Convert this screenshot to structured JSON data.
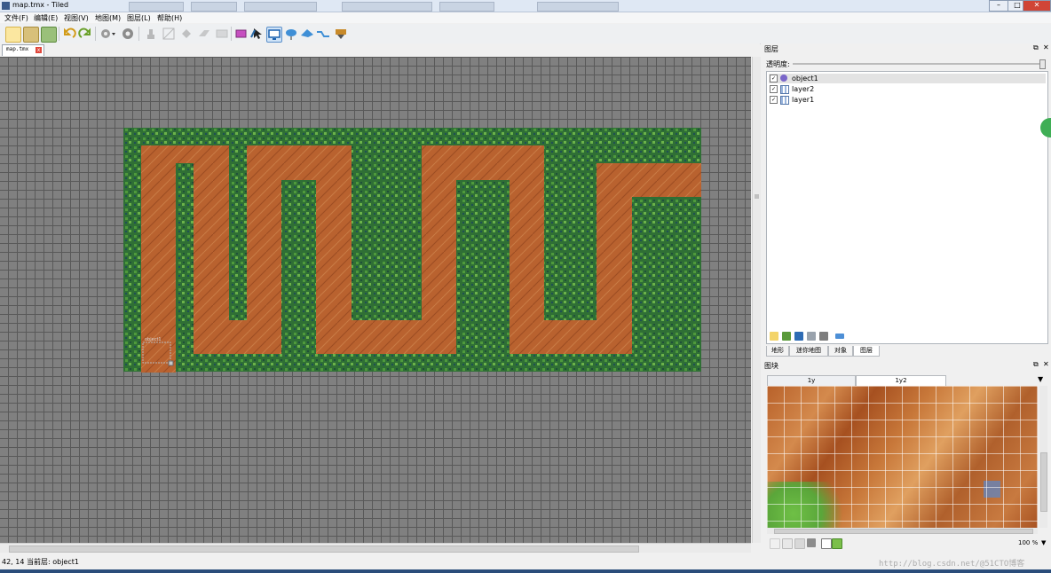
{
  "window": {
    "title": "map.tmx - Tiled",
    "controls": {
      "minimize": "–",
      "maximize": "□",
      "close": "✕"
    }
  },
  "menu": [
    "文件(F)",
    "编辑(E)",
    "视图(V)",
    "地图(M)",
    "图层(L)",
    "帮助(H)"
  ],
  "toolbar_icons": [
    "new-icon",
    "open-icon",
    "save-icon",
    "undo-icon",
    "redo-icon",
    "commands-icon",
    "command-settings-icon",
    "stamp-brush-icon",
    "terrain-brush-icon",
    "bucket-fill-icon",
    "eraser-icon",
    "rect-select-icon",
    "magic-wand-icon",
    "select-objects-icon",
    "edit-polygons-icon",
    "insert-rectangle-icon",
    "insert-ellipse-icon",
    "insert-polygon-icon",
    "insert-polyline-icon",
    "insert-tile-icon"
  ],
  "document_tab": {
    "label": "map.tmx",
    "close": "x"
  },
  "map": {
    "tile_colors": {
      "grass": "#2f6f35",
      "dirt": "#b9622f"
    },
    "object_label": "object1"
  },
  "status": {
    "text": "42, 14  当前层: object1"
  },
  "layers_panel": {
    "title": "图层",
    "opacity_label": "透明度:",
    "layers": [
      {
        "name": "object1",
        "visible": true,
        "type": "object"
      },
      {
        "name": "layer2",
        "visible": true,
        "type": "tile"
      },
      {
        "name": "layer1",
        "visible": true,
        "type": "tile"
      }
    ],
    "tabs": [
      "地形",
      "迷你地图",
      "对象",
      "图层"
    ],
    "active_tab": "图层"
  },
  "tileset_panel": {
    "title": "图块",
    "tabs": [
      "1y",
      "1y2"
    ],
    "active_tab": "1y2",
    "zoom": "100 %"
  },
  "watermark": "http://blog.csdn.net/@51CTO博客"
}
